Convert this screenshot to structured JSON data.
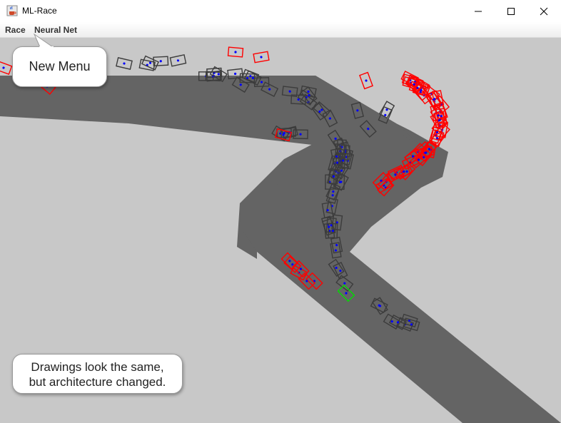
{
  "window": {
    "title": "ML-Race",
    "icon": "java-cup-icon",
    "controls": [
      "minimize-icon",
      "maximize-icon",
      "close-icon"
    ]
  },
  "menu": {
    "items": [
      "Race",
      "Neural Net"
    ]
  },
  "callouts": {
    "menu_note": "New Menu",
    "info_line1": "Drawings look the same,",
    "info_line2": "but architecture changed."
  },
  "simulation": {
    "colors": {
      "background": "#c8c8c8",
      "track": "#646464",
      "car_active": "#3c3c3c",
      "car_crashed": "#ff0000",
      "car_best": "#00dd00",
      "sensor_dot": "#0000ff"
    }
  }
}
